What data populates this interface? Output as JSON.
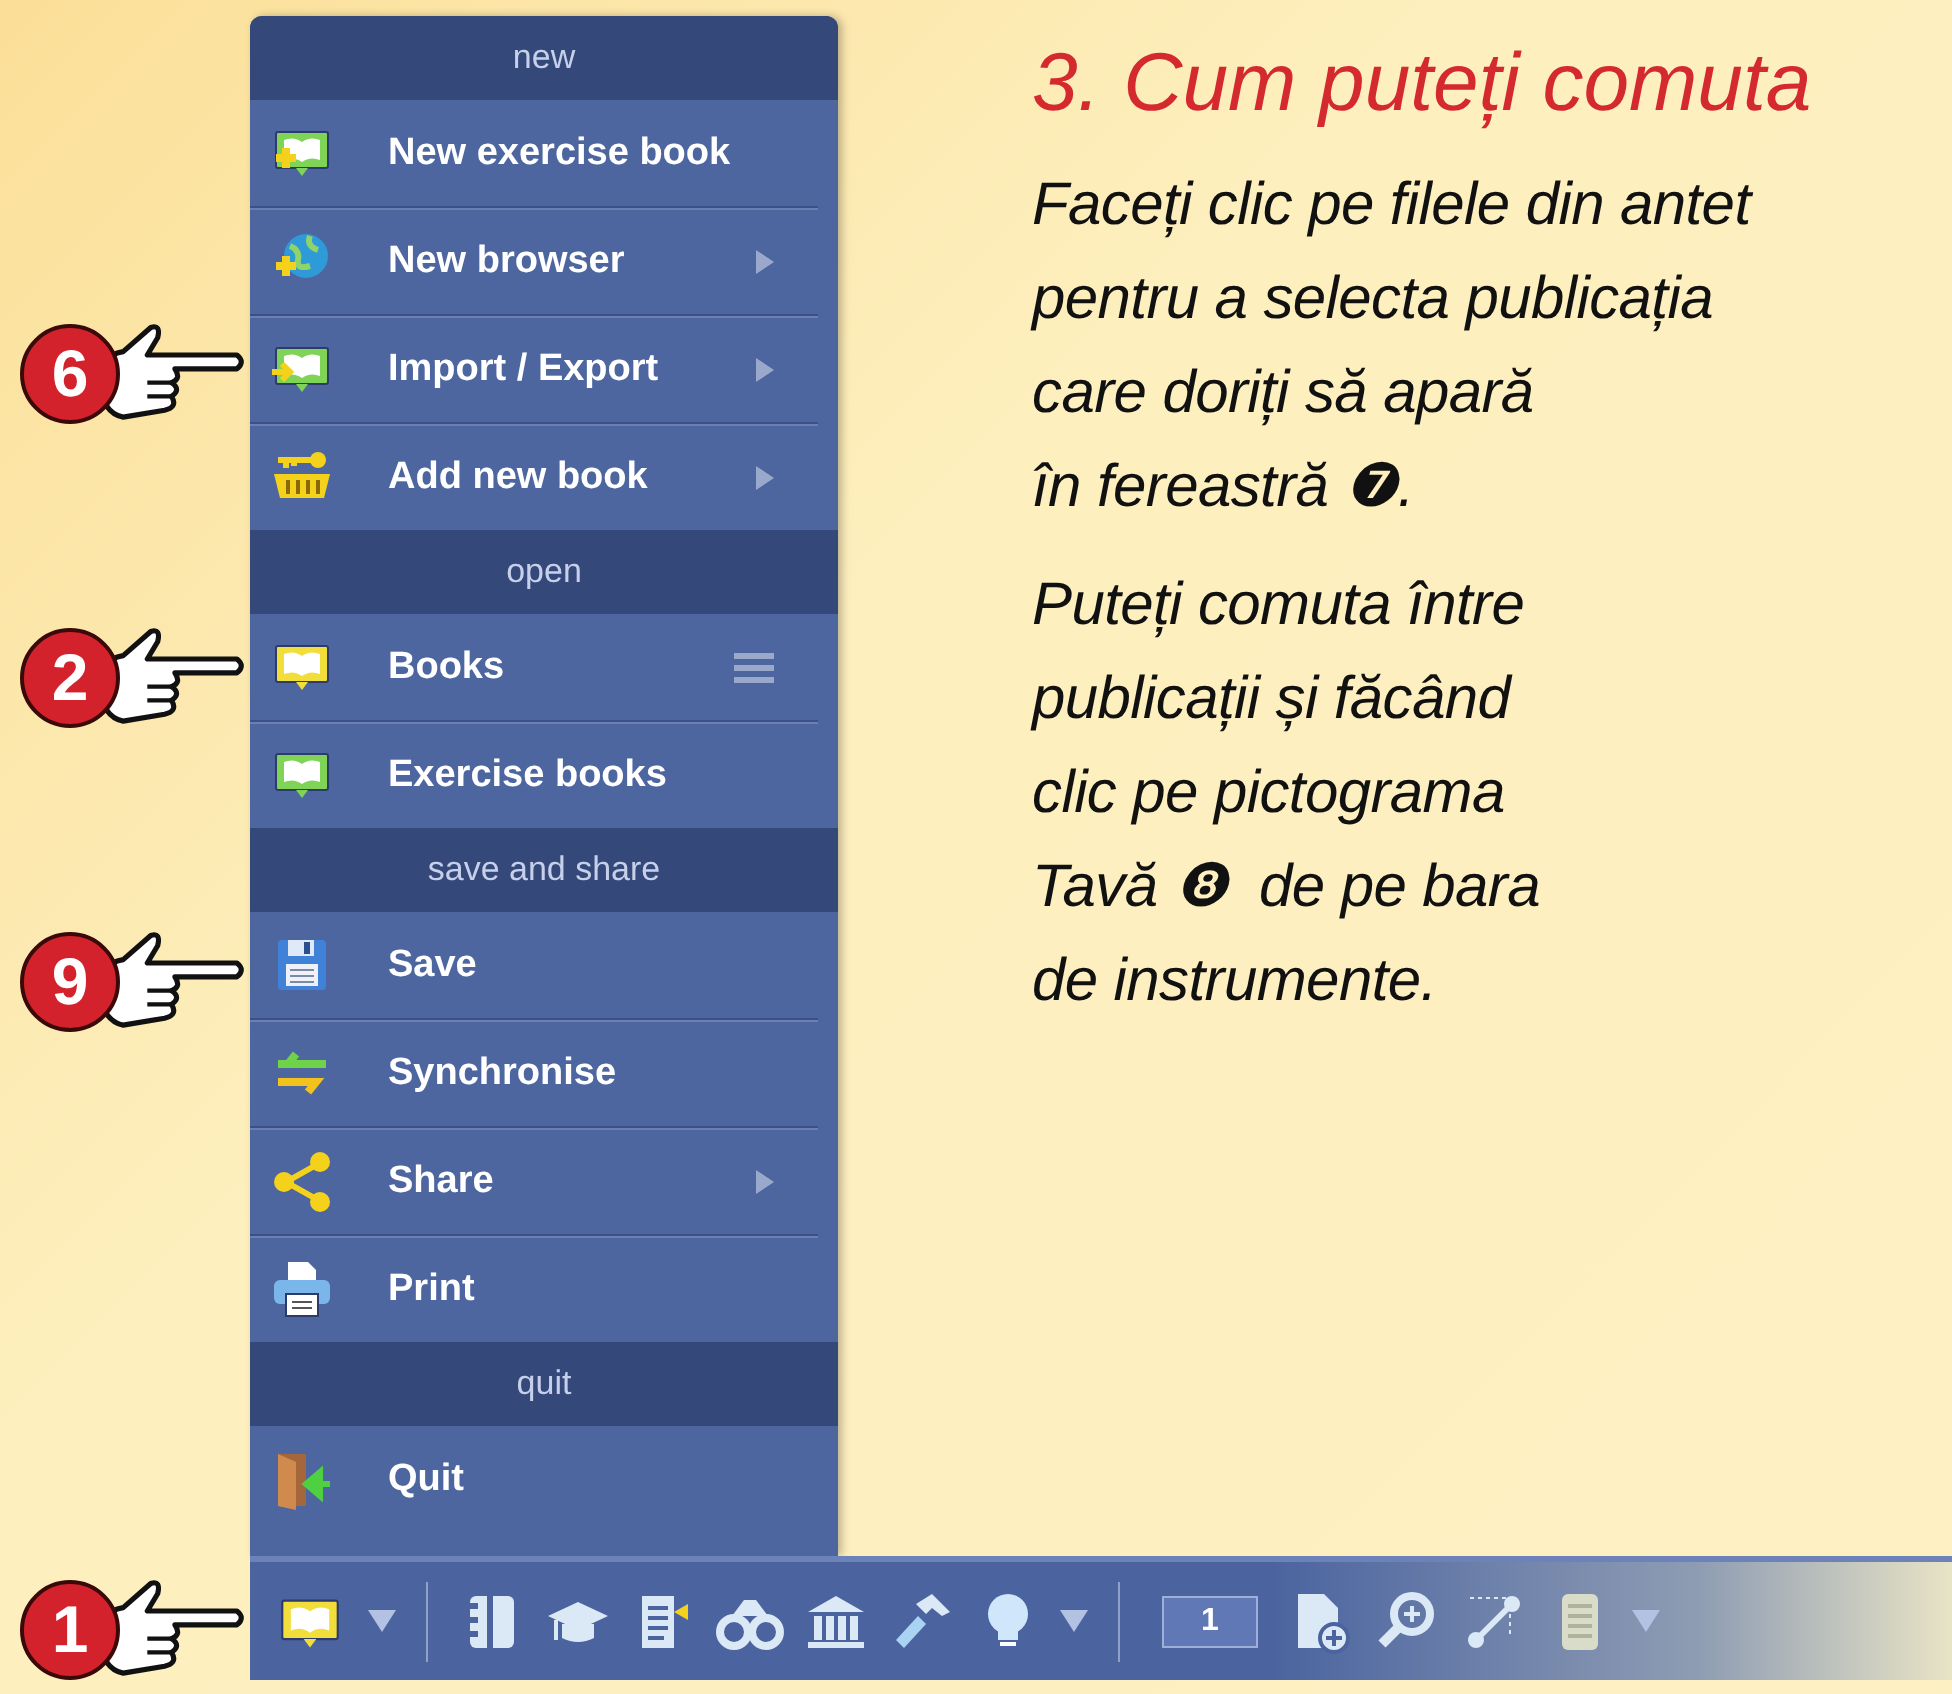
{
  "menu": {
    "sections": [
      {
        "header": "new",
        "items": [
          {
            "label": "New exercise book",
            "kind": "plain"
          },
          {
            "label": "New browser",
            "kind": "submenu"
          },
          {
            "label": "Import / Export",
            "kind": "submenu"
          },
          {
            "label": "Add new book",
            "kind": "submenu"
          }
        ]
      },
      {
        "header": "open",
        "items": [
          {
            "label": "Books",
            "kind": "list"
          },
          {
            "label": "Exercise books",
            "kind": "plain"
          }
        ]
      },
      {
        "header": "save and share",
        "items": [
          {
            "label": "Save",
            "kind": "plain"
          },
          {
            "label": "Synchronise",
            "kind": "plain"
          },
          {
            "label": "Share",
            "kind": "submenu"
          },
          {
            "label": "Print",
            "kind": "plain"
          }
        ]
      },
      {
        "header": "quit",
        "items": [
          {
            "label": "Quit",
            "kind": "plain"
          }
        ]
      }
    ]
  },
  "toolbar": {
    "page_field": {
      "value": "1"
    }
  },
  "help": {
    "heading": "3. Cum puteți comuta",
    "paragraphs": [
      "Faceți clic pe filele din antet\npentru a selecta publicația\ncare doriți să apară\nîn fereastră ❼.",
      "Puteți comuta între\npublicații și făcând\nclic pe pictograma\nTavă ❽  de pe bara\nde instrumente."
    ]
  },
  "callouts": [
    {
      "number": "6"
    },
    {
      "number": "2"
    },
    {
      "number": "9"
    },
    {
      "number": "1"
    }
  ]
}
